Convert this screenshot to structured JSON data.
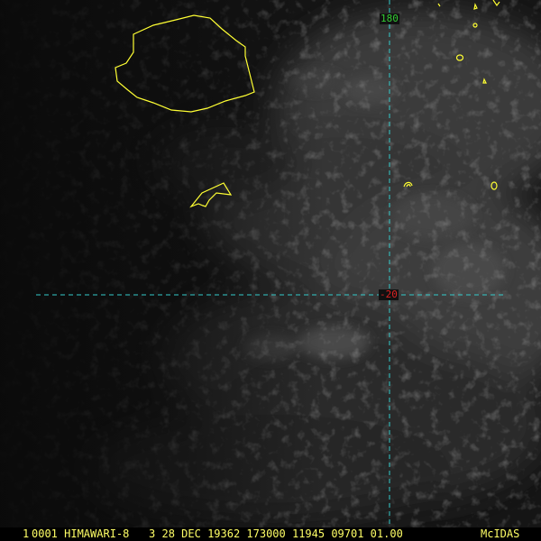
{
  "colors": {
    "background": "#111111",
    "cloud": "#6a6a6a",
    "coastline": "#ffff33",
    "grid": "#33cccc",
    "lon_label": "#33cc33",
    "lat_label": "#dd2222",
    "status_text": "#ffff66"
  },
  "grid": {
    "longitude_label": "180",
    "latitude_label": "-20"
  },
  "status_bar": {
    "frame_number": "1",
    "info": "0001 HIMAWARI-8   3 28 DEC 19362 173000 11945 09701 01.00",
    "brand": "McIDAS"
  }
}
